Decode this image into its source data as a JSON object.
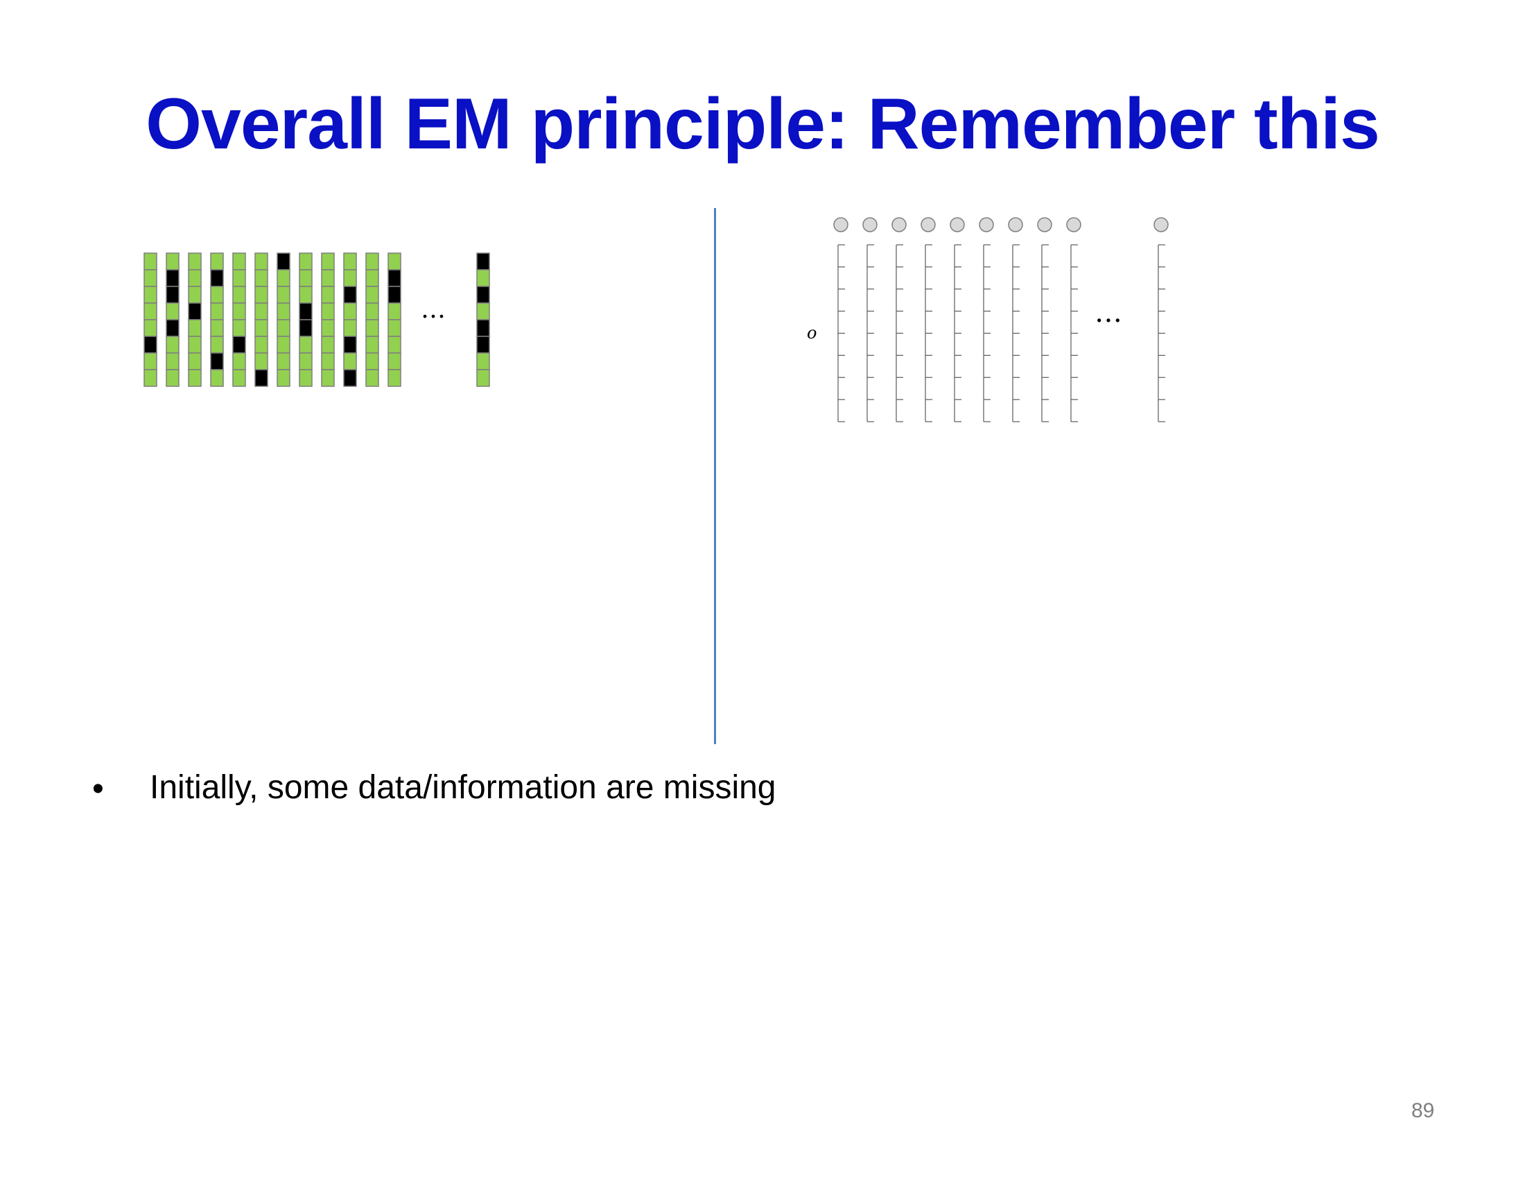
{
  "slide": {
    "title": "Overall EM principle: Remember this",
    "bullet_marker": "•",
    "bullet_text": "Initially, some data/information are missing",
    "page_number": "89"
  },
  "left_matrix": {
    "ellipsis": "…",
    "colors": {
      "green": "#92d050",
      "black": "#000000",
      "border": "#7f7f7f"
    },
    "columns": [
      [
        "g",
        "g",
        "g",
        "g",
        "g",
        "k",
        "g",
        "g"
      ],
      [
        "g",
        "k",
        "k",
        "g",
        "k",
        "g",
        "g",
        "g"
      ],
      [
        "g",
        "g",
        "g",
        "k",
        "g",
        "g",
        "g",
        "g"
      ],
      [
        "g",
        "k",
        "g",
        "g",
        "g",
        "g",
        "k",
        "g"
      ],
      [
        "g",
        "g",
        "g",
        "g",
        "g",
        "k",
        "g",
        "g"
      ],
      [
        "g",
        "g",
        "g",
        "g",
        "g",
        "g",
        "g",
        "k"
      ],
      [
        "k",
        "g",
        "g",
        "g",
        "g",
        "g",
        "g",
        "g"
      ],
      [
        "g",
        "g",
        "g",
        "k",
        "k",
        "g",
        "g",
        "g"
      ],
      [
        "g",
        "g",
        "g",
        "g",
        "g",
        "g",
        "g",
        "g"
      ],
      [
        "g",
        "g",
        "k",
        "g",
        "g",
        "k",
        "g",
        "k"
      ],
      [
        "g",
        "g",
        "g",
        "g",
        "g",
        "g",
        "g",
        "g"
      ],
      [
        "g",
        "k",
        "k",
        "g",
        "g",
        "g",
        "g",
        "g"
      ],
      [
        "k",
        "g",
        "k",
        "g",
        "k",
        "k",
        "g",
        "g"
      ]
    ]
  },
  "right_matrix": {
    "ellipsis": "…",
    "row_label": "o",
    "column_count": 10,
    "colors": {
      "node_fill": "#d9d9d9",
      "node_stroke": "#7f7f7f",
      "line": "#595959"
    }
  }
}
